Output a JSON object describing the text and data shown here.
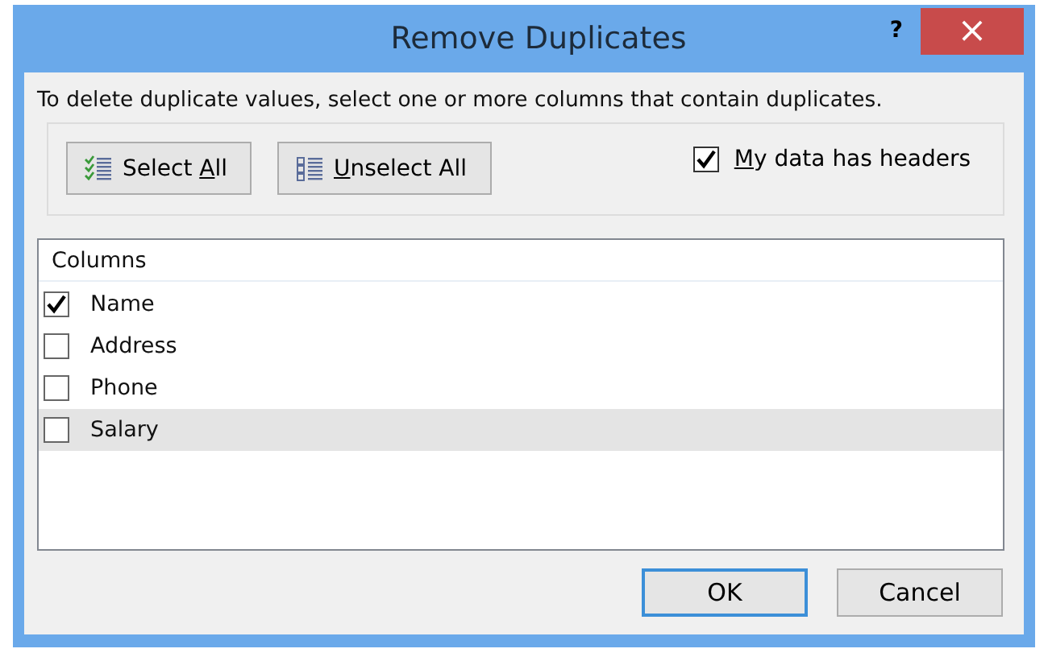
{
  "window": {
    "title": "Remove Duplicates",
    "help": "?",
    "close": "×"
  },
  "instruction": "To delete duplicate values, select one or more columns that contain duplicates.",
  "select_buttons": [
    {
      "kind": "select",
      "before": "Select ",
      "key": "A",
      "after": "ll"
    },
    {
      "kind": "unselect",
      "key": "U",
      "after": "nselect All"
    }
  ],
  "headers_checkbox": {
    "key": "M",
    "after": "y data has headers",
    "checked": true
  },
  "columns_list": {
    "header": "Columns",
    "items": [
      {
        "label": "Name",
        "checked": true,
        "selected": false
      },
      {
        "label": "Address",
        "checked": false,
        "selected": false
      },
      {
        "label": "Phone",
        "checked": false,
        "selected": false
      },
      {
        "label": "Salary",
        "checked": false,
        "selected": true
      }
    ]
  },
  "buttons": [
    {
      "label": "OK",
      "default": true
    },
    {
      "label": "Cancel",
      "default": false
    }
  ]
}
